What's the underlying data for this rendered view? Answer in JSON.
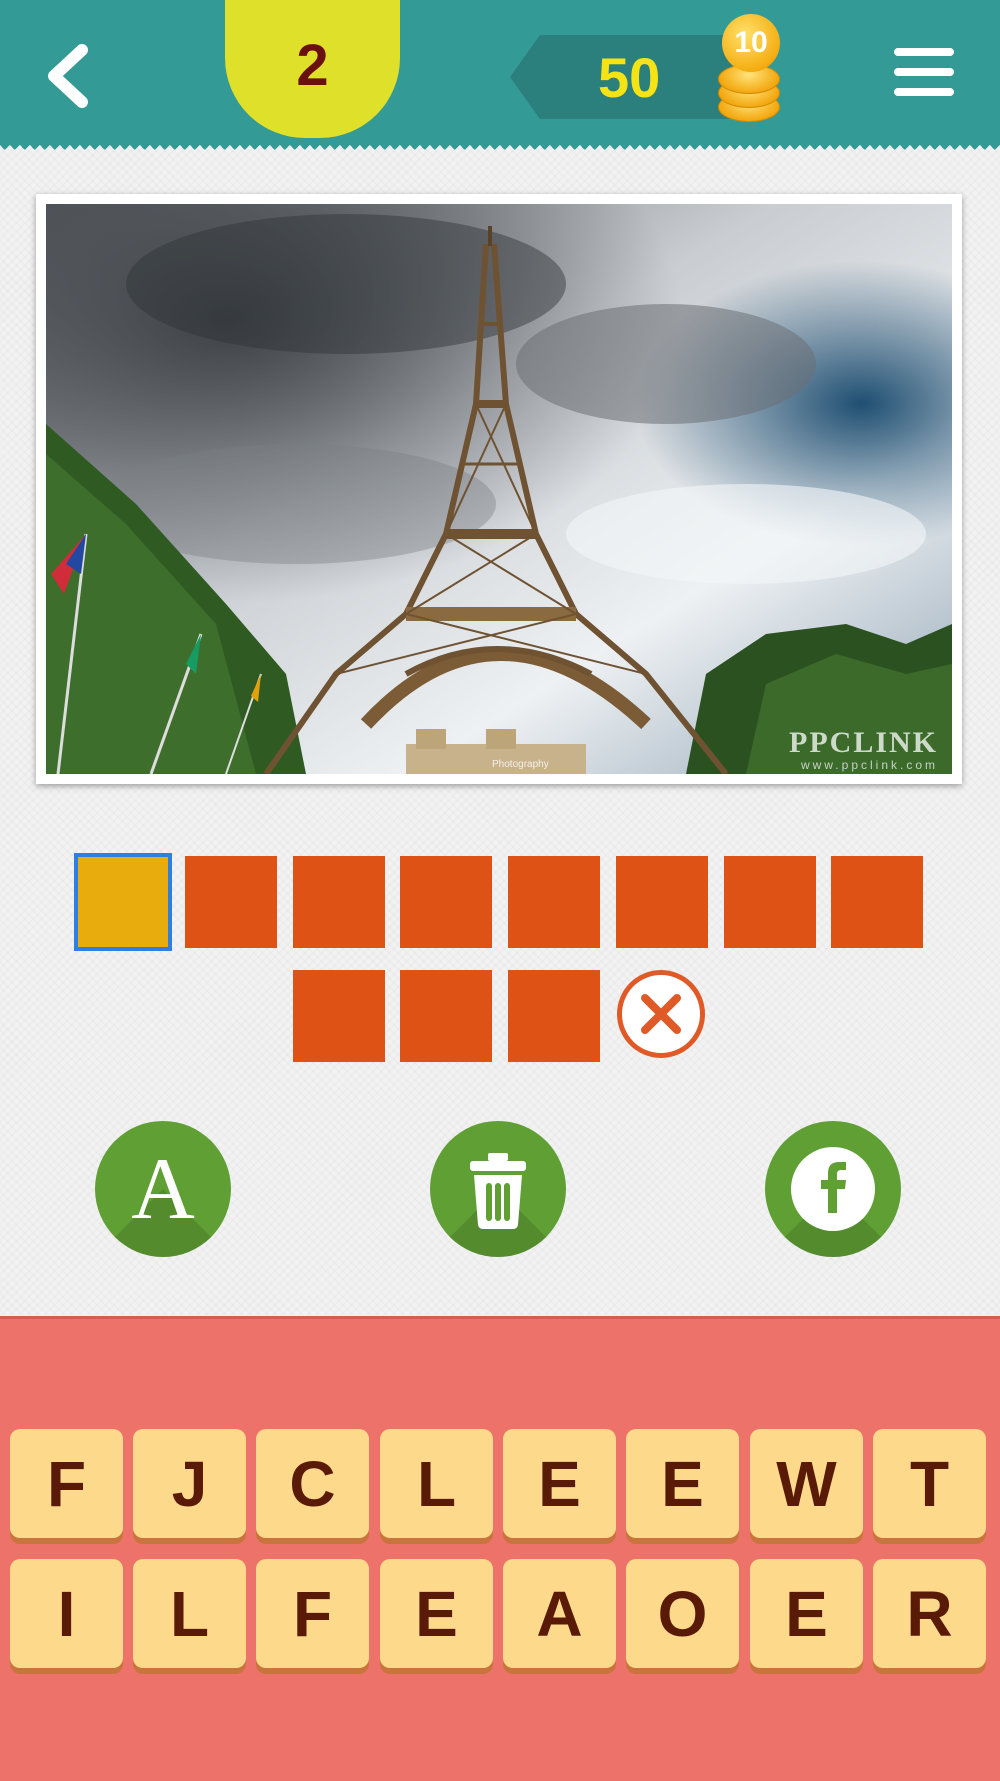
{
  "header": {
    "level": "2",
    "coins": "50",
    "coin_bonus": "10",
    "icons": {
      "back": "chevron-left-icon",
      "menu": "hamburger-menu-icon",
      "coins": "coin-stack-icon"
    }
  },
  "puzzle_image": {
    "subject": "Eiffel Tower under cloudy sky",
    "watermark": "PPCLINK",
    "watermark_sub": "www.ppclink.com",
    "credit": "Photography"
  },
  "answer": {
    "slot_count": 11,
    "active_slot": 0,
    "colors": {
      "slot": "#de5216",
      "active_slot": "#e8ac0c",
      "active_border": "#2d7fe3"
    }
  },
  "helpers": {
    "reveal_letter": "A",
    "remove_letters_icon": "trash-icon",
    "share_icon": "facebook-icon"
  },
  "keyboard": {
    "row1": [
      "F",
      "J",
      "C",
      "L",
      "E",
      "E",
      "W",
      "T"
    ],
    "row2": [
      "I",
      "L",
      "F",
      "E",
      "A",
      "O",
      "E",
      "R"
    ]
  },
  "colors": {
    "header": "#339a96",
    "level_badge": "#dfe02a",
    "coins_text": "#f6e315",
    "helper": "#5f9f34",
    "keyboard_bg": "#ec726a",
    "key": "#fdd98c",
    "key_text": "#5a1a08"
  }
}
